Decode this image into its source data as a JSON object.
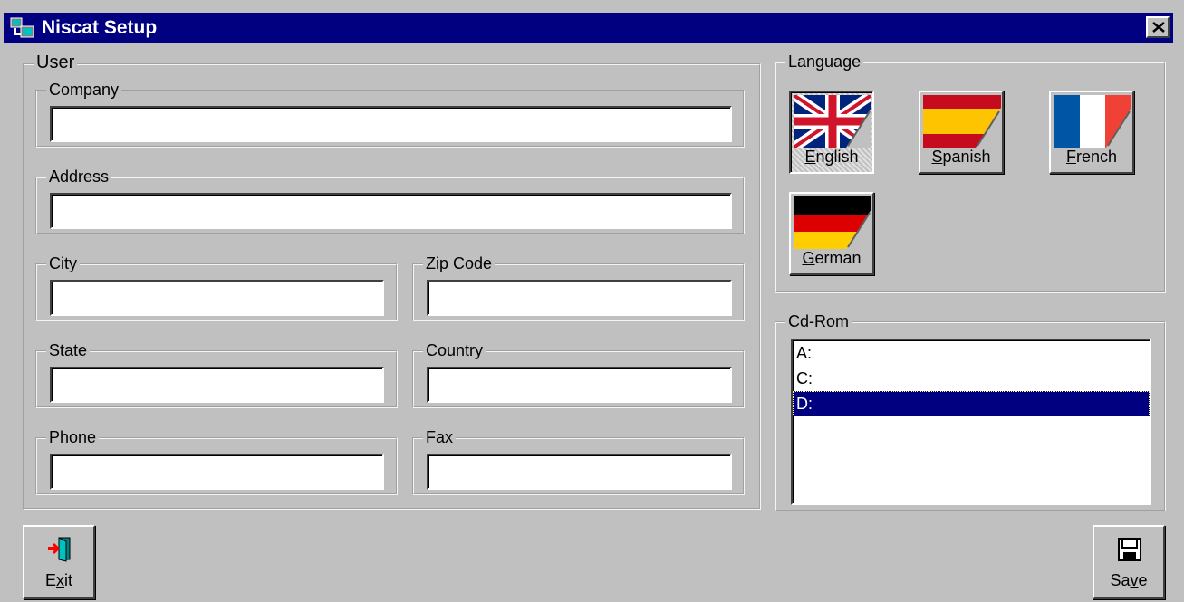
{
  "window": {
    "title": "Niscat Setup",
    "close_icon": "close-x-icon"
  },
  "user": {
    "legend": "User",
    "company": {
      "label": "Company",
      "value": ""
    },
    "address": {
      "label": "Address",
      "value": ""
    },
    "city": {
      "label": "City",
      "value": ""
    },
    "zip": {
      "label": "Zip Code",
      "value": ""
    },
    "state": {
      "label": "State",
      "value": ""
    },
    "country": {
      "label": "Country",
      "value": ""
    },
    "phone": {
      "label": "Phone",
      "value": ""
    },
    "fax": {
      "label": "Fax",
      "value": ""
    }
  },
  "language": {
    "legend": "Language",
    "selected": "English",
    "options": [
      {
        "label": "English",
        "mnemonic": "E",
        "rest": "nglish",
        "flag": "uk-flag-icon"
      },
      {
        "label": "Spanish",
        "mnemonic": "S",
        "rest": "panish",
        "flag": "spain-flag-icon"
      },
      {
        "label": "French",
        "mnemonic": "F",
        "rest": "rench",
        "flag": "france-flag-icon"
      },
      {
        "label": "German",
        "mnemonic": "G",
        "rest": "erman",
        "flag": "germany-flag-icon"
      }
    ]
  },
  "cdrom": {
    "legend": "Cd-Rom",
    "drives": [
      "A:",
      "C:",
      "D:"
    ],
    "selected": "D:"
  },
  "buttons": {
    "exit": {
      "pre": "E",
      "mnemonic": "x",
      "post": "it",
      "icon": "exit-door-icon"
    },
    "save": {
      "pre": "Sa",
      "mnemonic": "v",
      "post": "e",
      "icon": "floppy-disk-icon"
    }
  },
  "colors": {
    "titlebar": "#000080",
    "face": "#c0c0c0",
    "selection": "#000080"
  }
}
